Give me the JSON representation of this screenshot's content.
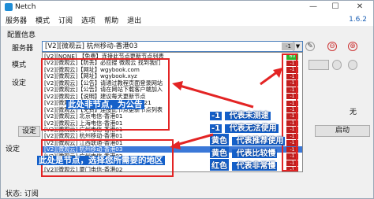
{
  "window": {
    "title": "Netch",
    "minimize": "—",
    "maximize": "☐",
    "close": "✕"
  },
  "menu": [
    "服务器",
    "模式",
    "订阅",
    "选项",
    "帮助",
    "退出"
  ],
  "version": "1.6.2",
  "config_label": "配置信息",
  "server_label": "服务器",
  "mode_label": "模式",
  "settings_label": "设定",
  "status_label": "状态: 订阅",
  "selected_server": "[V2][微观云] 杭州移动-香港03",
  "selected_badge": "-1",
  "server_buttons": [
    "✎",
    "⊖",
    "⊕"
  ],
  "servers": [
    {
      "name": "[V2][NONE] 【免费】连接此节点更新节点列表",
      "latency": "60",
      "color": "#2bb52b"
    },
    {
      "name": "[V2][微观云]【防丢】必应搜 微观云 找到我们",
      "latency": "-1",
      "color": "#c01e1e"
    },
    {
      "name": "[V2][微观云]【网址】wgybook.com",
      "latency": "-1",
      "color": "#c01e1e"
    },
    {
      "name": "[V2][微观云]【网址】wgybook.xyz",
      "latency": "-1",
      "color": "#c01e1e"
    },
    {
      "name": "[V2][微观云]【公告】请通过教程页面登录网站",
      "latency": "-1",
      "color": "#c01e1e"
    },
    {
      "name": "[V2][微观云]【公告】请在网站下载客户端加入",
      "latency": "-1",
      "color": "#c01e1e"
    },
    {
      "name": "[V2][微观云]【说明】建议每天更新节点",
      "latency": "-1",
      "color": "#c01e1e"
    },
    {
      "name": "[V2][微观云]【到期】2022-12-12 16:21",
      "latency": "-1",
      "color": "#c01e1e"
    },
    {
      "name": "[V2][微观云]【免费】连接此节点更新节点列表",
      "latency": "-1",
      "color": "#c01e1e"
    },
    {
      "name": "[V2][微观云] 北京电信-香港01",
      "latency": "-1",
      "color": "#c01e1e"
    },
    {
      "name": "[V2][微观云] 上海电信-香港01",
      "latency": "-1",
      "color": "#c01e1e"
    },
    {
      "name": "[V2][微观云] 广州电信-香港01",
      "latency": "-1",
      "color": "#c01e1e"
    },
    {
      "name": "[V2][微观云] 杭州移动-香港01",
      "latency": "-1",
      "color": "#c01e1e"
    },
    {
      "name": "[V2][微观云] 江西联通-香港01",
      "latency": "-1",
      "color": "#c01e1e"
    },
    {
      "name": "[V2][微观云] 杭州移动-香港03",
      "latency": "-1",
      "color": "#c01e1e",
      "selected": true
    },
    {
      "name": "[V2][微观云] 广州电信-香港02",
      "latency": "-1",
      "color": "#c01e1e"
    },
    {
      "name": "[V2][微观云] 上海联通-香港02",
      "latency": "-1",
      "color": "#c01e1e"
    },
    {
      "name": "[V2][微观云] 厦门电信-香港02",
      "latency": "-1",
      "color": "#c01e1e"
    }
  ],
  "annotations": {
    "notice": "此处非节点，为公告",
    "select": "此处是节点，选择您所需要的地区"
  },
  "legend": [
    {
      "key": "-1",
      "text": "代表未测速",
      "color": "#1560c9"
    },
    {
      "key": "-1",
      "text": "代表无法使用",
      "color": "#1560c9"
    },
    {
      "key": "黄色",
      "text": "代表推荐使用",
      "color": "#1560c9"
    },
    {
      "key": "黄色",
      "text": "代表比较慢",
      "color": "#1560c9"
    },
    {
      "key": "红色",
      "text": "代表非常慢",
      "color": "#1560c9"
    }
  ],
  "side_labels": {
    "settings": "设定",
    "wu": "无"
  },
  "start_button": "启动",
  "colors": {
    "accent": "#3b78d8",
    "red": "#e32424",
    "green": "#2bb52b",
    "blue": "#1560c9"
  }
}
